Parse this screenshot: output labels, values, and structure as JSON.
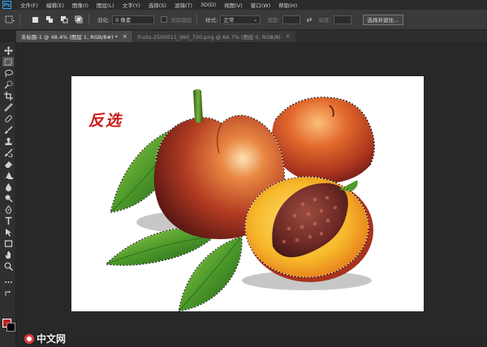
{
  "app": {
    "logo": "Ps"
  },
  "menu": [
    "文件(F)",
    "编辑(E)",
    "图像(I)",
    "图层(L)",
    "文字(Y)",
    "选择(S)",
    "滤镜(T)",
    "3D(D)",
    "视图(V)",
    "窗口(W)",
    "帮助(H)"
  ],
  "options": {
    "feather_label": "羽化:",
    "feather_value": "0 像素",
    "antialias_label": "消除锯齿",
    "style_label": "样式:",
    "style_value": "正常",
    "style_arrow": "⌄",
    "width_label": "宽度:",
    "swap_icon": "⇄",
    "height_label": "高度:",
    "select_mask_button": "选择并遮住..."
  },
  "tabs": [
    {
      "label": "未标题-1 @ 48.4% (图层 1, RGB/8#) *",
      "close": "×"
    },
    {
      "label": "fruits-2500011_960_720.png @ 66.7% (图层 0, RGB/8)",
      "close": "×"
    }
  ],
  "canvas": {
    "annotation": "反选"
  },
  "colors": {
    "foreground": "#c51a1a",
    "background": "#000000",
    "accent": "#31a8ff"
  },
  "watermark": {
    "text": "中文网"
  },
  "icons": [
    "move-icon",
    "marquee-icon",
    "lasso-icon",
    "quick-select-icon",
    "crop-icon",
    "eyedropper-icon",
    "healing-brush-icon",
    "brush-icon",
    "clone-stamp-icon",
    "history-brush-icon",
    "eraser-icon",
    "gradient-icon",
    "blur-icon",
    "dodge-icon",
    "pen-icon",
    "type-icon",
    "path-select-icon",
    "shape-icon",
    "hand-icon",
    "zoom-icon",
    "more-tools-icon"
  ]
}
